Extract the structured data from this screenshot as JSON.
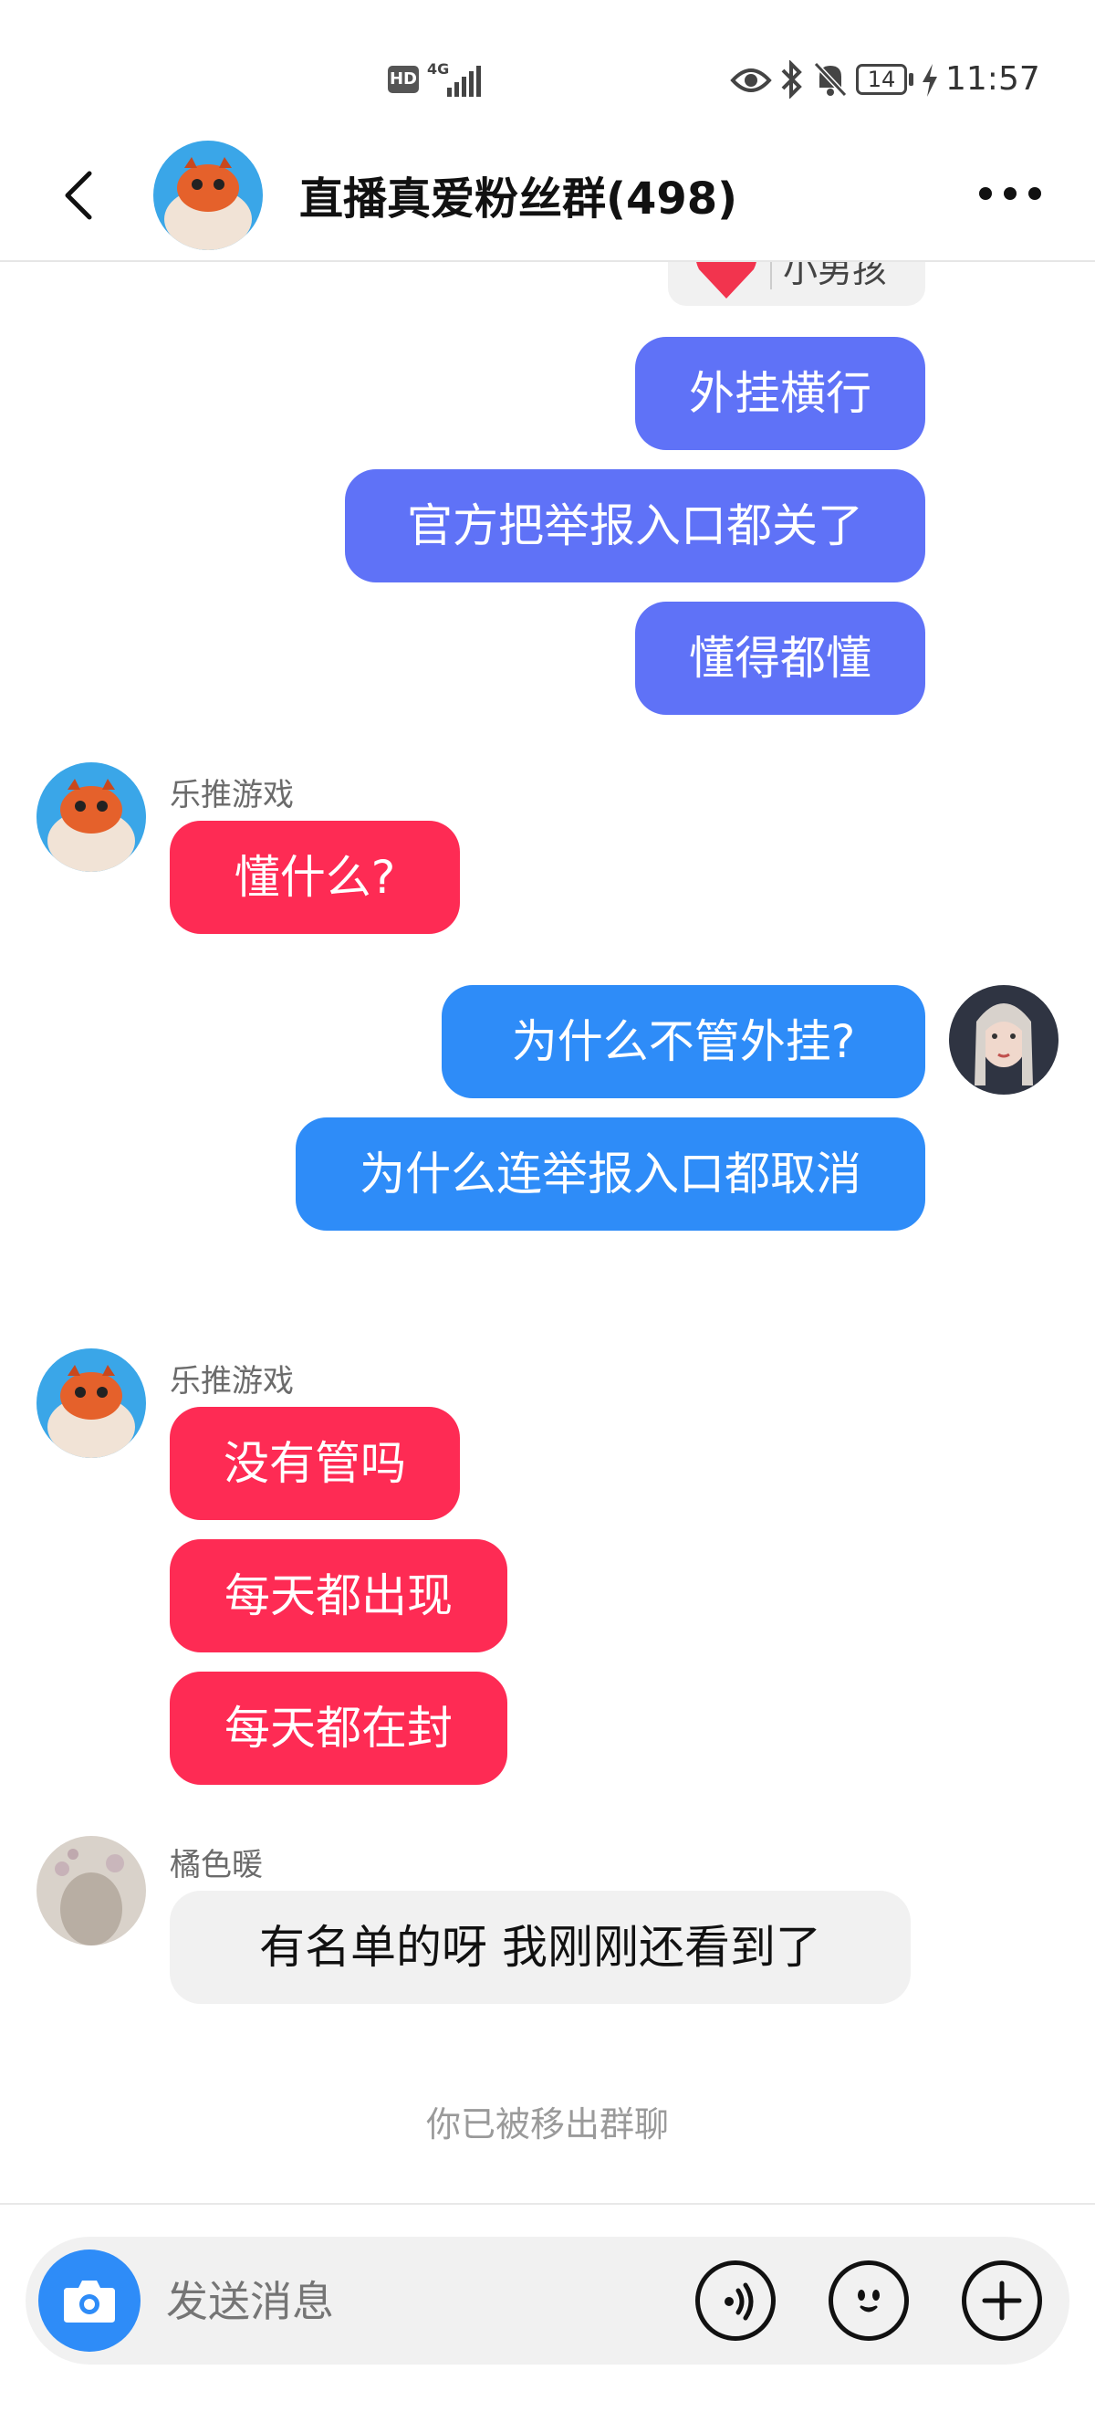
{
  "status_bar": {
    "hd": "HD",
    "network": "4G",
    "battery": "14",
    "time": "11:57"
  },
  "header": {
    "title": "直播真爱粉丝群(498)"
  },
  "messages": {
    "top_clipped": {
      "text": "小男孩"
    },
    "m1": {
      "text": "外挂横行"
    },
    "m2": {
      "text": "官方把举报入口都关了"
    },
    "m3": {
      "text": "懂得都懂"
    },
    "sender1": {
      "name": "乐推游戏"
    },
    "m4": {
      "text": "懂什么?"
    },
    "m5": {
      "text": "为什么不管外挂?"
    },
    "m6": {
      "text": "为什么连举报入口都取消"
    },
    "sender2": {
      "name": "乐推游戏"
    },
    "m7": {
      "text": "没有管吗"
    },
    "m8": {
      "text": "每天都出现"
    },
    "m9": {
      "text": "每天都在封"
    },
    "sender3": {
      "name": "橘色暖"
    },
    "m10": {
      "text": "有名单的呀 我刚刚还看到了"
    },
    "notice": "你已被移出群聊"
  },
  "input_bar": {
    "placeholder": "发送消息"
  },
  "colors": {
    "self_bubble_purple": "#5f72f7",
    "self_bubble_blue": "#2e8cf8",
    "other_bubble_red": "#fe2b54",
    "other_bubble_grey": "#f1f1f1",
    "camera_button": "#2e8cf8"
  }
}
